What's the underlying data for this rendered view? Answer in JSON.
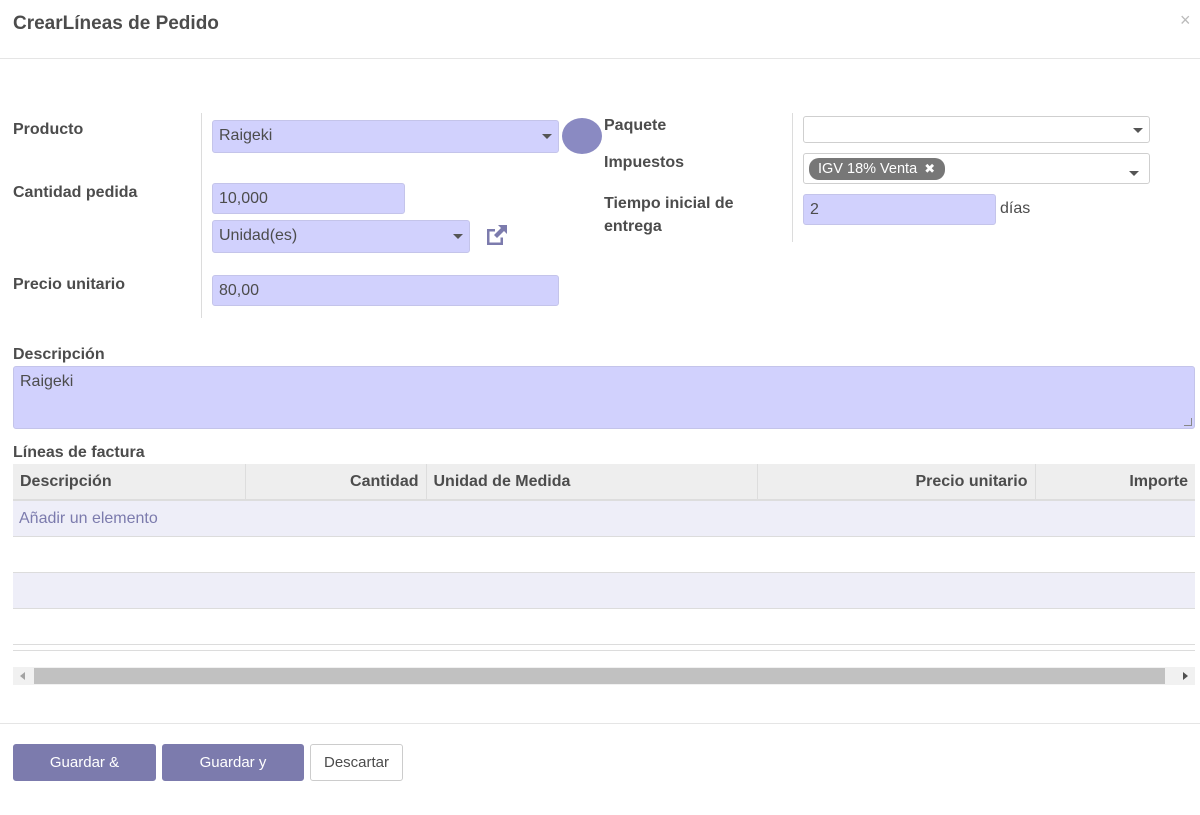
{
  "dialog": {
    "title": "CrearLíneas de Pedido",
    "close_icon": "×"
  },
  "form": {
    "product_label": "Producto",
    "product_value": "Raigeki",
    "qty_label": "Cantidad pedida",
    "qty_value": "10,000",
    "uom_value": "Unidad(es)",
    "price_label": "Precio unitario",
    "price_value": "80,00",
    "package_label": "Paquete",
    "package_value": "",
    "taxes_label": "Impuestos",
    "tax_tag": "IGV 18% Venta",
    "tax_tag_remove": "✖",
    "lead_label": "Tiempo inicial de entrega",
    "lead_value": "2",
    "lead_unit": "días",
    "description_label": "Descripción",
    "description_value": "Raigeki"
  },
  "invoice_lines": {
    "label": "Líneas de factura",
    "columns": [
      "Descripción",
      "Cantidad",
      "Unidad de Medida",
      "Precio unitario",
      "Importe"
    ],
    "add_item": "Añadir un elemento"
  },
  "buttons": {
    "save_close": "Guardar & Cerrar",
    "save_new": "Guardar y Nuevo",
    "discard": "Descartar"
  },
  "colors": {
    "primary": "#7c7bad",
    "field_bg": "#d1d1fd",
    "tag_bg": "#777777"
  },
  "icons": {
    "external_link": "external-link-icon",
    "dropdown": "chevron-down-icon"
  }
}
